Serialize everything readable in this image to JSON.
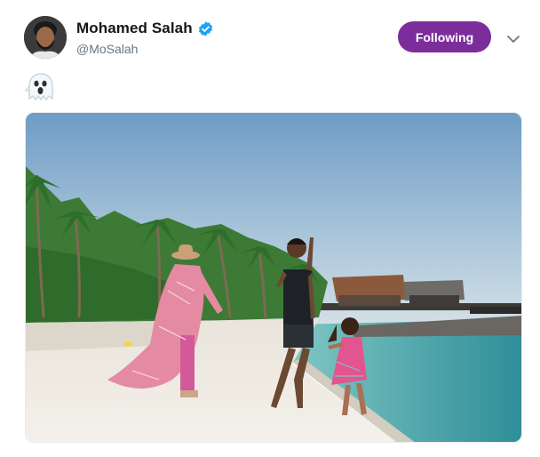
{
  "tweet": {
    "author": {
      "display_name": "Mohamed Salah",
      "handle": "@MoSalah",
      "verified": true,
      "avatar_icon": "profile-photo"
    },
    "follow_button": {
      "label": "Following",
      "color": "#7b2e9b"
    },
    "menu_icon": "chevron-down-icon",
    "text": {
      "emoji": "👻",
      "emoji_name": "ghost"
    },
    "media": {
      "type": "photo",
      "alt_icon": "beach-family-photo"
    }
  },
  "colors": {
    "name": "#14171a",
    "handle": "#657786",
    "verified_badge": "#1da1f2"
  }
}
